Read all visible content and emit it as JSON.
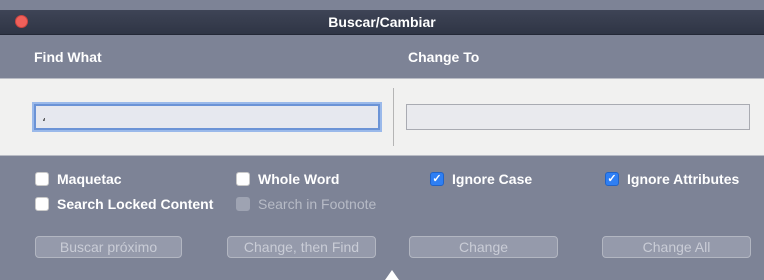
{
  "window": {
    "title": "Buscar/Cambiar"
  },
  "columns": {
    "find_label": "Find What",
    "change_label": "Change To"
  },
  "fields": {
    "find_value": "،",
    "change_value": ""
  },
  "options": [
    {
      "label": "Maquetac",
      "checked": false,
      "enabled": true
    },
    {
      "label": "Whole Word",
      "checked": false,
      "enabled": true
    },
    {
      "label": "Ignore Case",
      "checked": true,
      "enabled": true
    },
    {
      "label": "Ignore Attributes",
      "checked": true,
      "enabled": true
    },
    {
      "label": "Search Locked Content",
      "checked": false,
      "enabled": true
    },
    {
      "label": "Search in Footnote",
      "checked": false,
      "enabled": false
    }
  ],
  "buttons": {
    "find_next": "Buscar próximo",
    "change_then_find": "Change, then Find",
    "change": "Change",
    "change_all": "Change All"
  },
  "colors": {
    "checkbox_checked": "#2f7ff3",
    "close_button": "#f0605a",
    "panel_bg": "#7d8396"
  }
}
